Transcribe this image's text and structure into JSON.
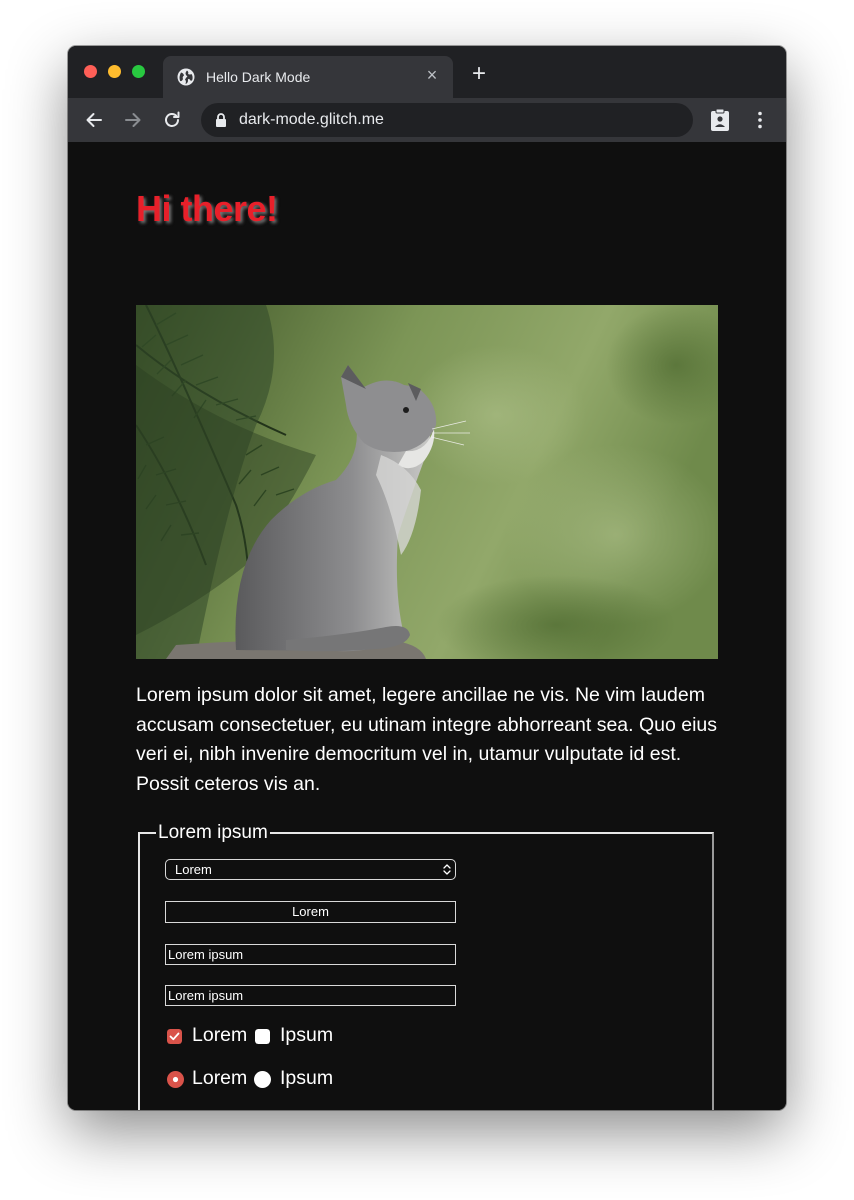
{
  "browser": {
    "tab_title": "Hello Dark Mode",
    "tab_close": "×",
    "new_tab": "+",
    "url": "dark-mode.glitch.me"
  },
  "page": {
    "heading": "Hi there!",
    "heading_color": "#e8202a",
    "paragraph": "Lorem ipsum dolor sit amet, legere ancillae ne vis. Ne vim laudem accusam consectetuer, eu utinam integre abhorreant sea. Quo eius veri ei, nibh invenire democritum vel in, utamur vulputate id est. Possit ceteros vis an.",
    "form": {
      "legend": "Lorem ipsum",
      "select_value": "Lorem",
      "button_label": "Lorem",
      "input1_value": "Lorem ipsum",
      "input2_value": "Lorem ipsum",
      "checkboxes": [
        {
          "label": "Lorem",
          "checked": true
        },
        {
          "label": "Ipsum",
          "checked": false
        }
      ],
      "radios": [
        {
          "label": "Lorem",
          "checked": true
        },
        {
          "label": "Ipsum",
          "checked": false
        }
      ],
      "accent_color": "#d9534a"
    }
  }
}
